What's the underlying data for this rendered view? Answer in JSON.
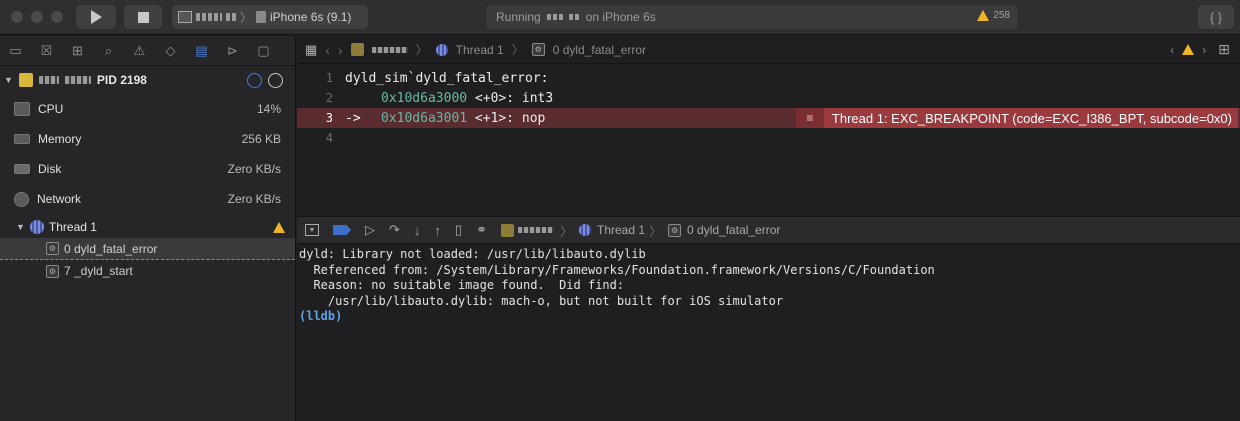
{
  "toolbar": {
    "device": "iPhone 6s (9.1)",
    "status_prefix": "Running",
    "status_suffix": "on iPhone 6s",
    "warning_count": "258"
  },
  "navigator": {
    "process": {
      "pid": "PID 2198"
    },
    "gauges": [
      {
        "label": "CPU",
        "value": "14%"
      },
      {
        "label": "Memory",
        "value": "256 KB"
      },
      {
        "label": "Disk",
        "value": "Zero KB/s"
      },
      {
        "label": "Network",
        "value": "Zero KB/s"
      }
    ],
    "thread": {
      "label": "Thread 1"
    },
    "frames": [
      {
        "label": "0 dyld_fatal_error"
      },
      {
        "label": "7 _dyld_start"
      }
    ]
  },
  "editor": {
    "jumpbar": {
      "thread": "Thread 1",
      "frame": "0 dyld_fatal_error"
    },
    "lines": [
      {
        "num": "1",
        "prefix": "",
        "addr": "",
        "text": "dyld_sim`dyld_fatal_error:"
      },
      {
        "num": "2",
        "prefix": "",
        "addr": "0x10d6a3000",
        "text": " <+0>: int3"
      },
      {
        "num": "3",
        "prefix": "->",
        "addr": "0x10d6a3001",
        "text": " <+1>: nop"
      },
      {
        "num": "4",
        "prefix": "",
        "addr": "",
        "text": ""
      }
    ],
    "error_message": "Thread 1: EXC_BREAKPOINT (code=EXC_I386_BPT, subcode=0x0)"
  },
  "debugbar": {
    "thread": "Thread 1",
    "frame": "0 dyld_fatal_error"
  },
  "console": {
    "lines": [
      "dyld: Library not loaded: /usr/lib/libauto.dylib",
      "  Referenced from: /System/Library/Frameworks/Foundation.framework/Versions/C/Foundation",
      "  Reason: no suitable image found.  Did find:",
      "    /usr/lib/libauto.dylib: mach-o, but not built for iOS simulator"
    ],
    "prompt": "(lldb)"
  }
}
